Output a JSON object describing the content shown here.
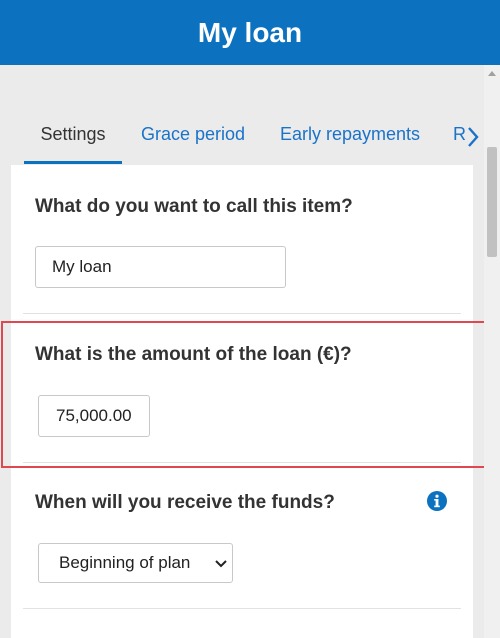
{
  "header": {
    "title": "My loan"
  },
  "tabs": [
    {
      "label": "Settings",
      "active": true
    },
    {
      "label": "Grace period",
      "active": false
    },
    {
      "label": "Early repayments",
      "active": false
    },
    {
      "label": "R",
      "active": false
    }
  ],
  "form": {
    "name": {
      "question": "What do you want to call this item?",
      "value": "My loan"
    },
    "amount": {
      "question": "What is the amount of the loan (€)?",
      "value": "75,000.00"
    },
    "funds": {
      "question": "When will you receive the funds?",
      "selected": "Beginning of plan"
    }
  },
  "colors": {
    "brand": "#0c72c0",
    "highlight": "#e0484f",
    "link": "#1a73c9"
  },
  "icons": {
    "info": "info-icon",
    "next": "chevron-right-icon",
    "dropdown": "chevron-down-icon"
  }
}
